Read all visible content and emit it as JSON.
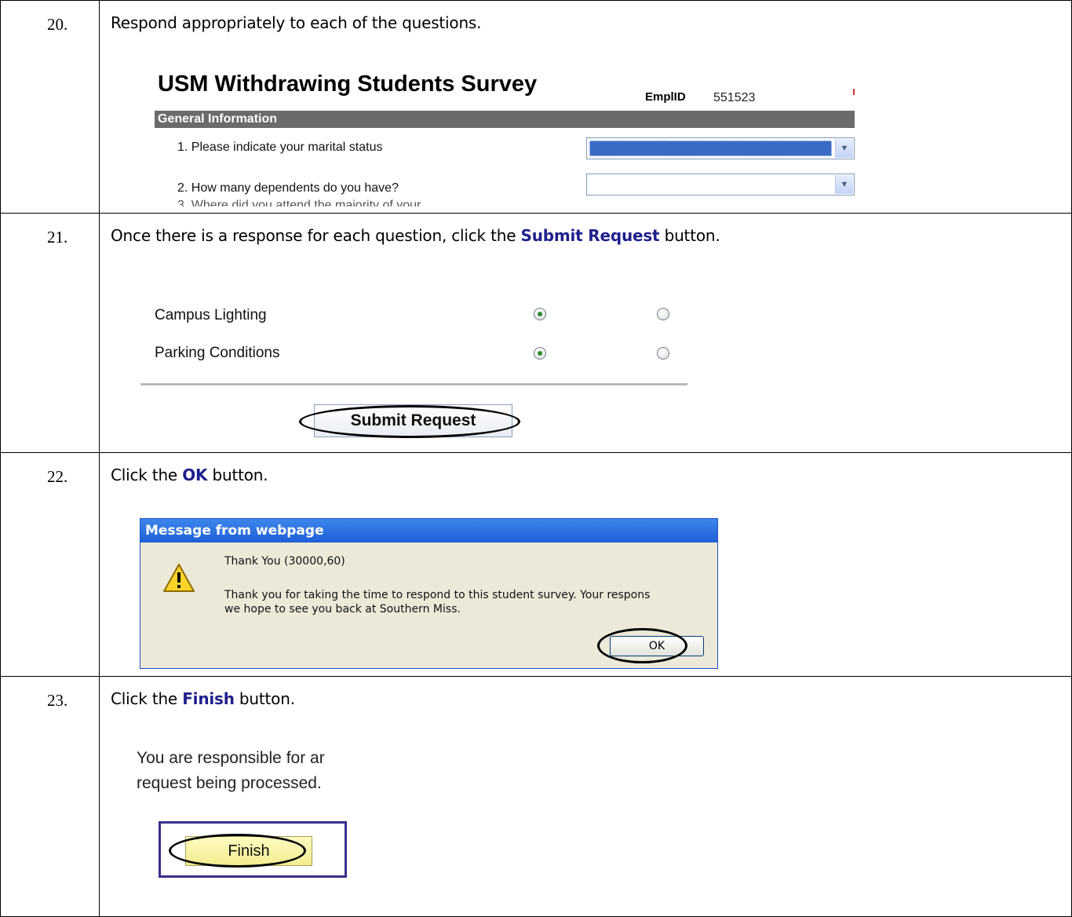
{
  "steps": [
    {
      "number": "20.",
      "instruction": "Respond appropriately to each of the questions.",
      "survey": {
        "title": "USM Withdrawing Students Survey",
        "emplid_label": "EmplID",
        "emplid_value": "551523",
        "section": "General Information",
        "questions": [
          "1. Please indicate your marital status",
          "2. How many dependents do you have?",
          "3. Where did you attend the majority of your"
        ]
      }
    },
    {
      "number": "21.",
      "instruction_pre": "Once there is a response for each question, click the ",
      "instruction_bold": "Submit Request",
      "instruction_post": " button.",
      "options": [
        {
          "label": "Campus Lighting",
          "selected_first": true
        },
        {
          "label": "Parking Conditions",
          "selected_first": true
        }
      ],
      "submit_label": "Submit Request"
    },
    {
      "number": "22.",
      "instruction_pre": "Click the ",
      "instruction_bold": "OK",
      "instruction_post": " button.",
      "dialog": {
        "title": "Message from webpage",
        "heading": "Thank You (30000,60)",
        "line1": "Thank you for taking the time to respond to this student survey.  Your respons",
        "line2": "we hope to see you back at Southern Miss.",
        "ok_label": "OK"
      }
    },
    {
      "number": "23.",
      "instruction_pre": "Click the ",
      "instruction_bold": "Finish",
      "instruction_post": " button.",
      "text_line1": "You are responsible for ar",
      "text_line2": "request being processed.",
      "finish_label": "Finish"
    }
  ],
  "colors": {
    "instruction_bold": "#1f1f8c",
    "section_bar": "#6b6b6b",
    "dialog_title": "#1f5fd8",
    "finish_button": "#f7f1a0"
  }
}
